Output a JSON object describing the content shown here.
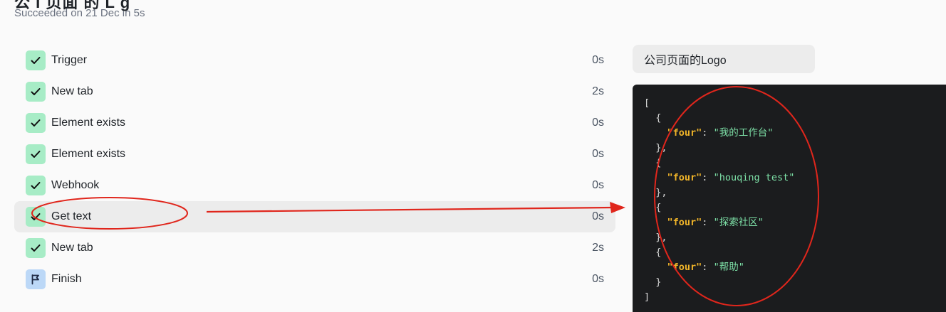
{
  "header": {
    "title_fragment": "公 I 页面 的 L g",
    "subtitle": "Succeeded on 21 Dec in 5s"
  },
  "steps": [
    {
      "label": "Trigger",
      "duration": "0s",
      "status": "success"
    },
    {
      "label": "New tab",
      "duration": "2s",
      "status": "success"
    },
    {
      "label": "Element exists",
      "duration": "0s",
      "status": "success"
    },
    {
      "label": "Element exists",
      "duration": "0s",
      "status": "success"
    },
    {
      "label": "Webhook",
      "duration": "0s",
      "status": "success"
    },
    {
      "label": "Get text",
      "duration": "0s",
      "status": "success",
      "selected": true
    },
    {
      "label": "New tab",
      "duration": "2s",
      "status": "success"
    },
    {
      "label": "Finish",
      "duration": "0s",
      "status": "finish"
    }
  ],
  "output": {
    "label": "公司页面的Logo",
    "key": "\"four\"",
    "values": [
      "\"我的工作台\"",
      "\"houqing test\"",
      "\"探索社区\"",
      "\"帮助\""
    ]
  },
  "colors": {
    "success_bg": "#a7ecc6",
    "finish_bg": "#bcd8f7",
    "json_key": "#f0b429",
    "json_string": "#7ee2a8",
    "annotation": "#e0261c"
  },
  "icons": {
    "success": "check-icon",
    "finish": "flag-icon"
  }
}
